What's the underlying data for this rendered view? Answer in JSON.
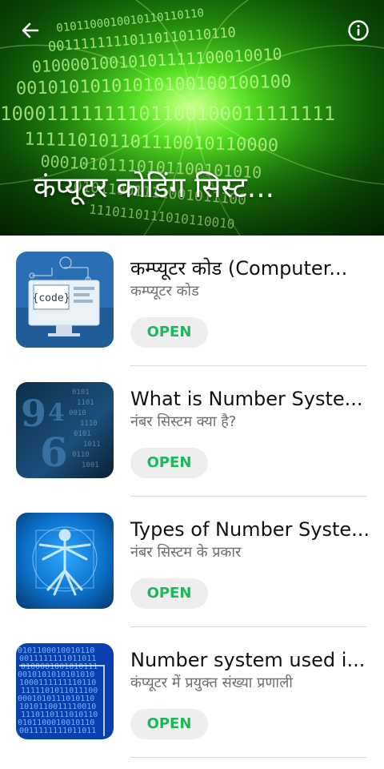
{
  "header": {
    "title": "कंप्यूटर कोडिंग सिस्ट...",
    "back_icon": "arrow-left-icon",
    "info_icon": "info-circle-icon",
    "binary_rows": [
      "0101100010010110110110",
      "00111111110110110110110",
      "01000010010101111100010010",
      "00101010101010100100100100",
      "10001111111101100100011111111",
      "111110101101110010110000",
      "00010101110101100101010",
      "101011001111001011100",
      "1110110111010110010"
    ],
    "accent": "#35c418"
  },
  "items": [
    {
      "title": "कम्प्यूटर कोड (Computer...",
      "subtitle": "कम्प्यूटर कोड",
      "button": "OPEN",
      "thumb_text": "{code}"
    },
    {
      "title": "What is Number Syste...",
      "subtitle": "नंबर सिस्टम क्या है?",
      "button": "OPEN"
    },
    {
      "title": "Types of Number Syste...",
      "subtitle": "नंबर सिस्टम के प्रकार",
      "button": "OPEN"
    },
    {
      "title": "Number system used i...",
      "subtitle": "कंप्यूटर में प्रयुक्त संख्या प्रणाली",
      "button": "OPEN"
    }
  ],
  "colors": {
    "button_text": "#1eb85a",
    "button_bg": "#eeeeee",
    "title": "#111111",
    "subtitle": "#6f6f6f"
  }
}
